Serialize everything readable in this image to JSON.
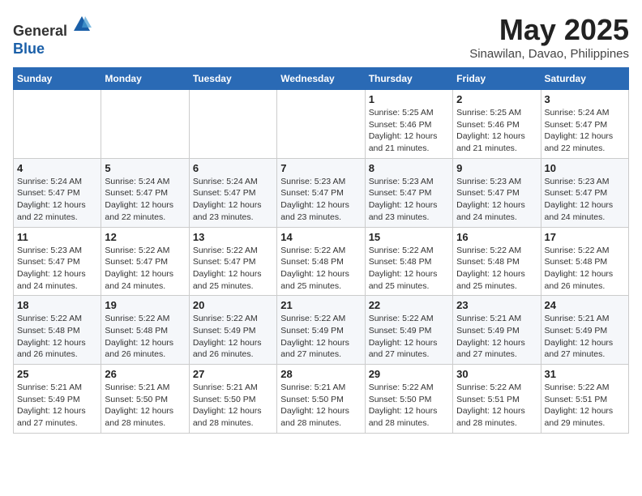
{
  "header": {
    "logo_line1": "General",
    "logo_line2": "Blue",
    "month_title": "May 2025",
    "location": "Sinawilan, Davao, Philippines"
  },
  "weekdays": [
    "Sunday",
    "Monday",
    "Tuesday",
    "Wednesday",
    "Thursday",
    "Friday",
    "Saturday"
  ],
  "weeks": [
    [
      {
        "day": "",
        "info": ""
      },
      {
        "day": "",
        "info": ""
      },
      {
        "day": "",
        "info": ""
      },
      {
        "day": "",
        "info": ""
      },
      {
        "day": "1",
        "info": "Sunrise: 5:25 AM\nSunset: 5:46 PM\nDaylight: 12 hours\nand 21 minutes."
      },
      {
        "day": "2",
        "info": "Sunrise: 5:25 AM\nSunset: 5:46 PM\nDaylight: 12 hours\nand 21 minutes."
      },
      {
        "day": "3",
        "info": "Sunrise: 5:24 AM\nSunset: 5:47 PM\nDaylight: 12 hours\nand 22 minutes."
      }
    ],
    [
      {
        "day": "4",
        "info": "Sunrise: 5:24 AM\nSunset: 5:47 PM\nDaylight: 12 hours\nand 22 minutes."
      },
      {
        "day": "5",
        "info": "Sunrise: 5:24 AM\nSunset: 5:47 PM\nDaylight: 12 hours\nand 22 minutes."
      },
      {
        "day": "6",
        "info": "Sunrise: 5:24 AM\nSunset: 5:47 PM\nDaylight: 12 hours\nand 23 minutes."
      },
      {
        "day": "7",
        "info": "Sunrise: 5:23 AM\nSunset: 5:47 PM\nDaylight: 12 hours\nand 23 minutes."
      },
      {
        "day": "8",
        "info": "Sunrise: 5:23 AM\nSunset: 5:47 PM\nDaylight: 12 hours\nand 23 minutes."
      },
      {
        "day": "9",
        "info": "Sunrise: 5:23 AM\nSunset: 5:47 PM\nDaylight: 12 hours\nand 24 minutes."
      },
      {
        "day": "10",
        "info": "Sunrise: 5:23 AM\nSunset: 5:47 PM\nDaylight: 12 hours\nand 24 minutes."
      }
    ],
    [
      {
        "day": "11",
        "info": "Sunrise: 5:23 AM\nSunset: 5:47 PM\nDaylight: 12 hours\nand 24 minutes."
      },
      {
        "day": "12",
        "info": "Sunrise: 5:22 AM\nSunset: 5:47 PM\nDaylight: 12 hours\nand 24 minutes."
      },
      {
        "day": "13",
        "info": "Sunrise: 5:22 AM\nSunset: 5:47 PM\nDaylight: 12 hours\nand 25 minutes."
      },
      {
        "day": "14",
        "info": "Sunrise: 5:22 AM\nSunset: 5:48 PM\nDaylight: 12 hours\nand 25 minutes."
      },
      {
        "day": "15",
        "info": "Sunrise: 5:22 AM\nSunset: 5:48 PM\nDaylight: 12 hours\nand 25 minutes."
      },
      {
        "day": "16",
        "info": "Sunrise: 5:22 AM\nSunset: 5:48 PM\nDaylight: 12 hours\nand 25 minutes."
      },
      {
        "day": "17",
        "info": "Sunrise: 5:22 AM\nSunset: 5:48 PM\nDaylight: 12 hours\nand 26 minutes."
      }
    ],
    [
      {
        "day": "18",
        "info": "Sunrise: 5:22 AM\nSunset: 5:48 PM\nDaylight: 12 hours\nand 26 minutes."
      },
      {
        "day": "19",
        "info": "Sunrise: 5:22 AM\nSunset: 5:48 PM\nDaylight: 12 hours\nand 26 minutes."
      },
      {
        "day": "20",
        "info": "Sunrise: 5:22 AM\nSunset: 5:49 PM\nDaylight: 12 hours\nand 26 minutes."
      },
      {
        "day": "21",
        "info": "Sunrise: 5:22 AM\nSunset: 5:49 PM\nDaylight: 12 hours\nand 27 minutes."
      },
      {
        "day": "22",
        "info": "Sunrise: 5:22 AM\nSunset: 5:49 PM\nDaylight: 12 hours\nand 27 minutes."
      },
      {
        "day": "23",
        "info": "Sunrise: 5:21 AM\nSunset: 5:49 PM\nDaylight: 12 hours\nand 27 minutes."
      },
      {
        "day": "24",
        "info": "Sunrise: 5:21 AM\nSunset: 5:49 PM\nDaylight: 12 hours\nand 27 minutes."
      }
    ],
    [
      {
        "day": "25",
        "info": "Sunrise: 5:21 AM\nSunset: 5:49 PM\nDaylight: 12 hours\nand 27 minutes."
      },
      {
        "day": "26",
        "info": "Sunrise: 5:21 AM\nSunset: 5:50 PM\nDaylight: 12 hours\nand 28 minutes."
      },
      {
        "day": "27",
        "info": "Sunrise: 5:21 AM\nSunset: 5:50 PM\nDaylight: 12 hours\nand 28 minutes."
      },
      {
        "day": "28",
        "info": "Sunrise: 5:21 AM\nSunset: 5:50 PM\nDaylight: 12 hours\nand 28 minutes."
      },
      {
        "day": "29",
        "info": "Sunrise: 5:22 AM\nSunset: 5:50 PM\nDaylight: 12 hours\nand 28 minutes."
      },
      {
        "day": "30",
        "info": "Sunrise: 5:22 AM\nSunset: 5:51 PM\nDaylight: 12 hours\nand 28 minutes."
      },
      {
        "day": "31",
        "info": "Sunrise: 5:22 AM\nSunset: 5:51 PM\nDaylight: 12 hours\nand 29 minutes."
      }
    ]
  ]
}
